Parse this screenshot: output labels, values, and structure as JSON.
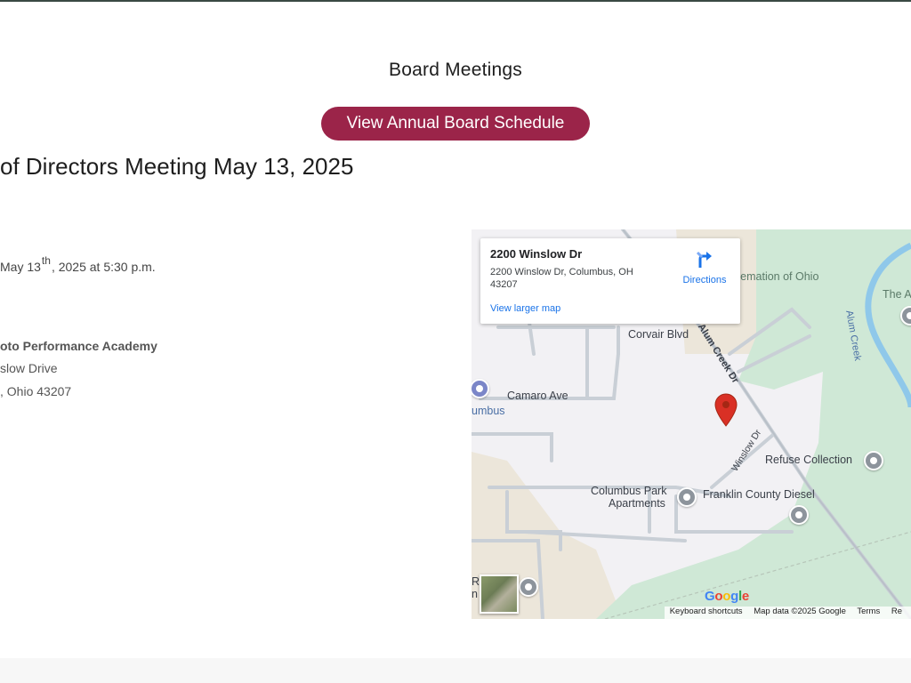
{
  "header": {
    "heading": "Board Meetings",
    "schedule_button": "View Annual Board Schedule"
  },
  "meeting": {
    "title": "of Directors Meeting May 13, 2025",
    "date_prefix": "May 13",
    "date_sup": "th",
    "date_suffix": ", 2025 at 5:30 p.m.",
    "venue": "oto Performance Academy",
    "street": "slow Drive",
    "city": ", Ohio 43207"
  },
  "map": {
    "place_name": "2200 Winslow Dr",
    "place_address": "2200 Winslow Dr, Columbus, OH 43207",
    "directions": "Directions",
    "larger_map": "View larger map",
    "labels": {
      "cremation": "remation of Ohio",
      "the_a": "The A",
      "alum_creek": "Alum Creek",
      "alum_creek_dr": "Alum Creek Dr",
      "corvair": "Corvair Blvd",
      "camaro": "Camaro Ave",
      "umbus": "umbus",
      "winslow": "Winslow Dr",
      "refuse": "Refuse Collection",
      "columbus_park_1": "Columbus Park",
      "columbus_park_2": "Apartments",
      "franklin": "Franklin County Diesel",
      "re": "Re",
      "n": "n"
    },
    "google": "Google",
    "footer": {
      "shortcuts": "Keyboard shortcuts",
      "map_data": "Map data ©2025 Google",
      "terms": "Terms",
      "report": "Re"
    },
    "colors": {
      "park": "#cfe8d6",
      "road": "#c9cfd6",
      "water": "#8fc8ea",
      "pin": "#d93025"
    }
  },
  "theme": {
    "button_color": "#9b2449"
  }
}
